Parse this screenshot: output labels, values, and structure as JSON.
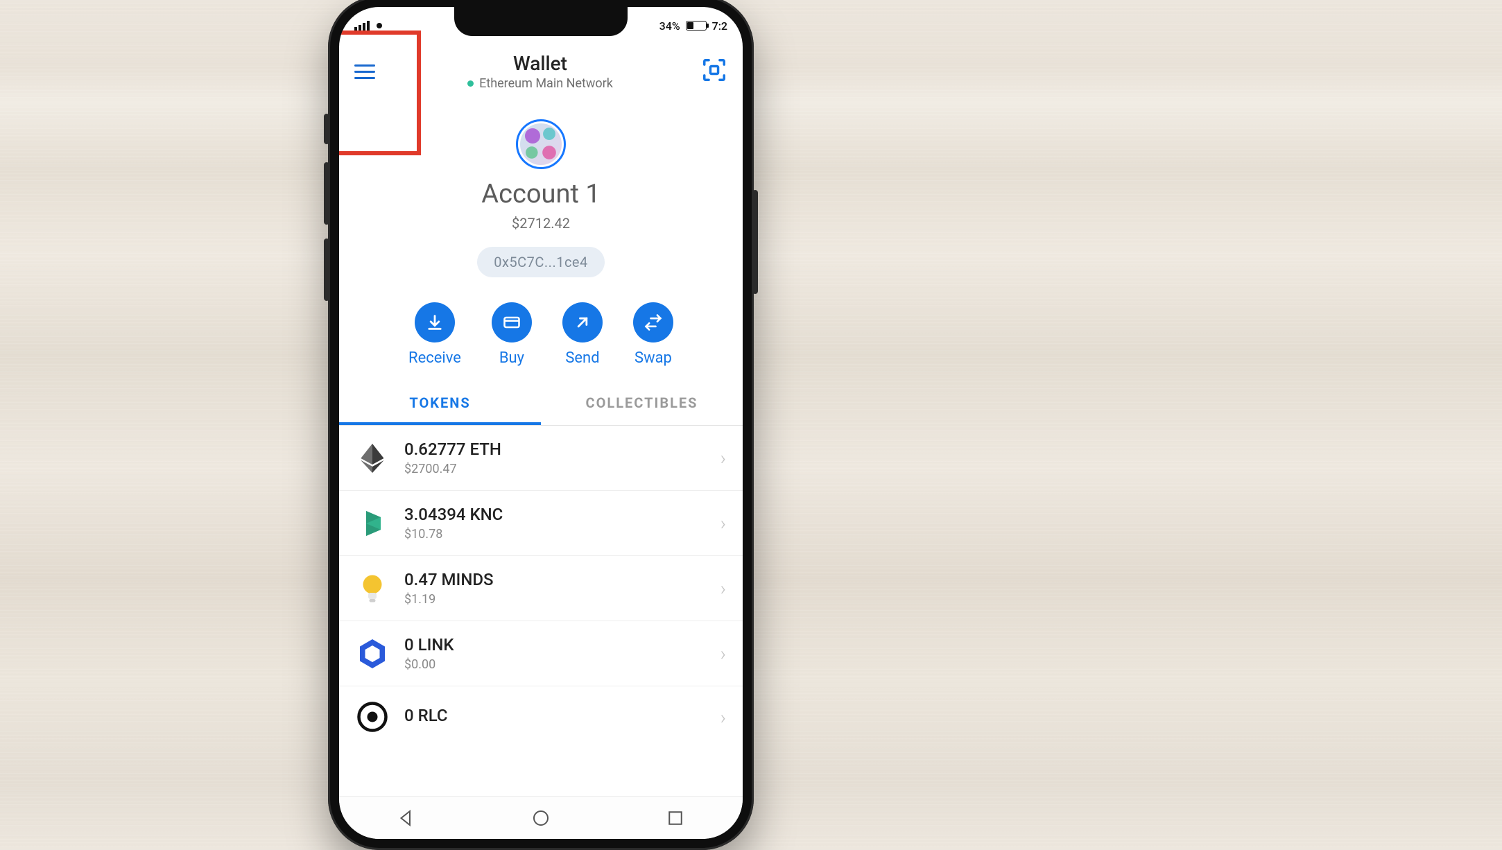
{
  "status": {
    "battery_pct": "34%",
    "time": "7:2"
  },
  "header": {
    "title": "Wallet",
    "network": "Ethereum Main Network"
  },
  "account": {
    "name": "Account 1",
    "balance_fiat": "$2712.42",
    "address_short": "0x5C7C...1ce4"
  },
  "actions": {
    "receive": "Receive",
    "buy": "Buy",
    "send": "Send",
    "swap": "Swap"
  },
  "tabs": {
    "tokens": "TOKENS",
    "collectibles": "COLLECTIBLES"
  },
  "tokens": [
    {
      "amount": "0.62777 ETH",
      "fiat": "$2700.47",
      "icon": "eth"
    },
    {
      "amount": "3.04394 KNC",
      "fiat": "$10.78",
      "icon": "knc"
    },
    {
      "amount": "0.47 MINDS",
      "fiat": "$1.19",
      "icon": "minds"
    },
    {
      "amount": "0 LINK",
      "fiat": "$0.00",
      "icon": "link"
    },
    {
      "amount": "0 RLC",
      "fiat": "",
      "icon": "rlc"
    }
  ]
}
